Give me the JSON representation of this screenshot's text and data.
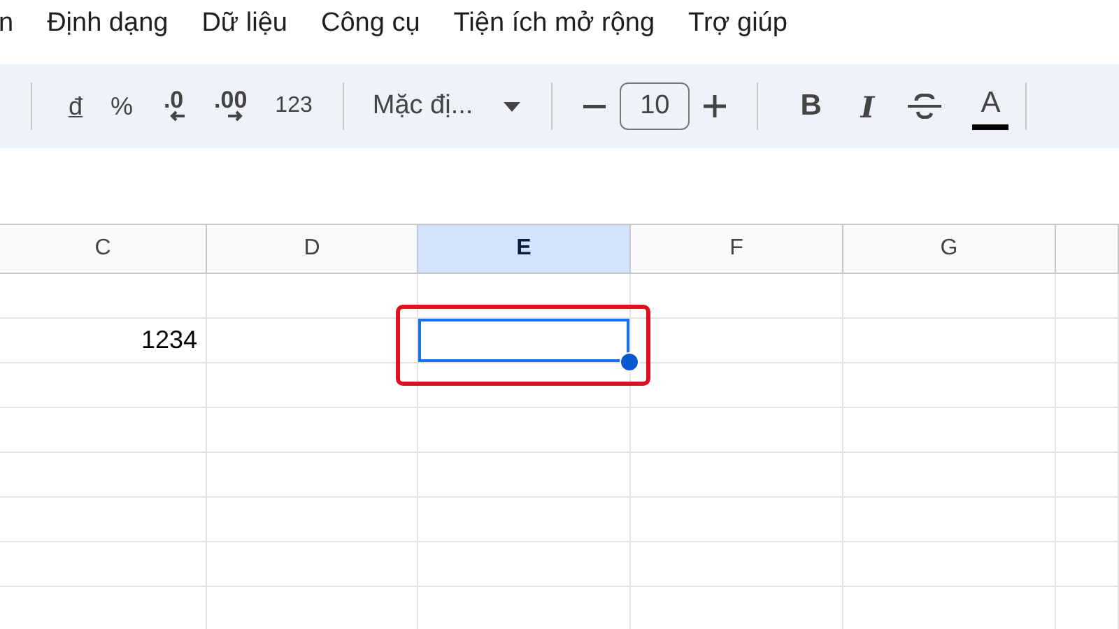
{
  "menu": [
    {
      "label": "n"
    },
    {
      "label": "Định dạng"
    },
    {
      "label": "Dữ liệu"
    },
    {
      "label": "Công cụ"
    },
    {
      "label": "Tiện ích mở rộng"
    },
    {
      "label": "Trợ giúp"
    }
  ],
  "toolbar": {
    "currency": "đ",
    "percent": "%",
    "decrease_decimal": ".0",
    "increase_decimal": ".00",
    "number_format": "123",
    "font": "Mặc đị...",
    "font_size": "10",
    "bold": "B",
    "italic": "I",
    "text_color": "A"
  },
  "columns": [
    {
      "label": "C",
      "selected": false
    },
    {
      "label": "D",
      "selected": false
    },
    {
      "label": "E",
      "selected": true
    },
    {
      "label": "F",
      "selected": false
    },
    {
      "label": "G",
      "selected": false
    }
  ],
  "rows": [
    {
      "cells": [
        {
          "selected": false
        },
        {
          "selected": false
        },
        {
          "selected": false
        },
        {
          "selected": false
        },
        {
          "selected": false
        }
      ]
    },
    {
      "cells": [
        {
          "value": "1234",
          "selected": false
        },
        {
          "selected": false
        },
        {
          "selected": true,
          "highlighted": true
        },
        {
          "selected": false
        },
        {
          "selected": false
        }
      ]
    },
    {
      "cells": [
        {
          "selected": false
        },
        {
          "selected": false
        },
        {
          "selected": false
        },
        {
          "selected": false
        },
        {
          "selected": false
        }
      ]
    },
    {
      "cells": [
        {
          "selected": false
        },
        {
          "selected": false
        },
        {
          "selected": false
        },
        {
          "selected": false
        },
        {
          "selected": false
        }
      ]
    },
    {
      "cells": [
        {
          "selected": false
        },
        {
          "selected": false
        },
        {
          "selected": false
        },
        {
          "selected": false
        },
        {
          "selected": false
        }
      ]
    },
    {
      "cells": [
        {
          "selected": false
        },
        {
          "selected": false
        },
        {
          "selected": false
        },
        {
          "selected": false
        },
        {
          "selected": false
        }
      ]
    },
    {
      "cells": [
        {
          "selected": false
        },
        {
          "selected": false
        },
        {
          "selected": false
        },
        {
          "selected": false
        },
        {
          "selected": false
        }
      ]
    },
    {
      "cells": [
        {
          "selected": false
        },
        {
          "selected": false
        },
        {
          "selected": false
        },
        {
          "selected": false
        },
        {
          "selected": false
        }
      ]
    }
  ]
}
